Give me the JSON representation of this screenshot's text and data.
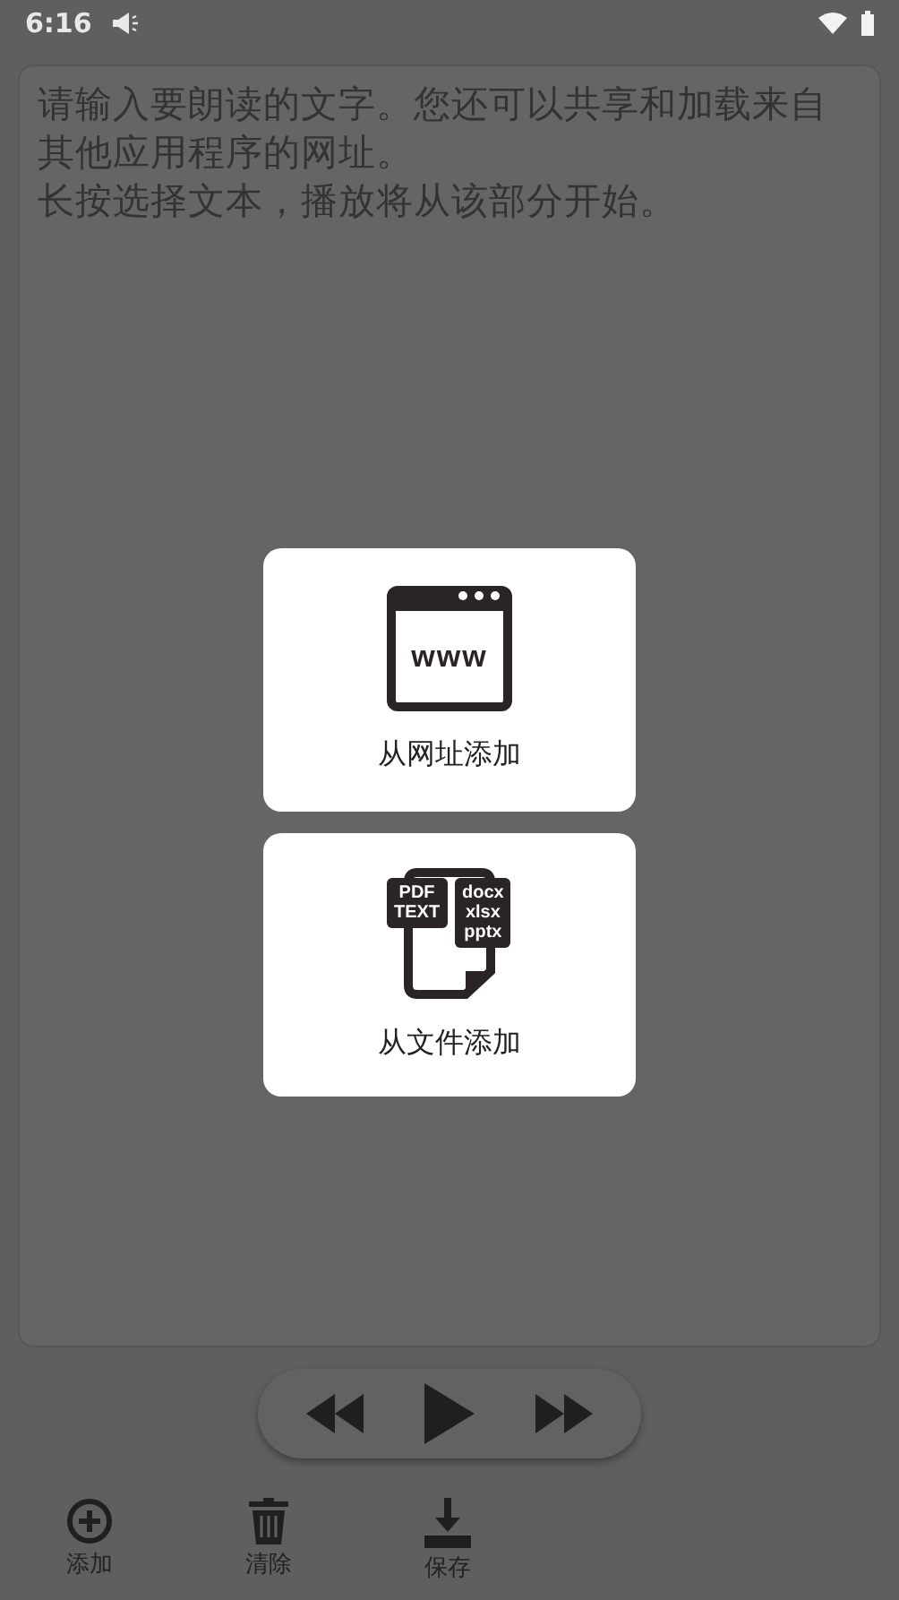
{
  "status_bar": {
    "time": "6:16"
  },
  "text_area": {
    "placeholder_lines": [
      "请输入要朗读的文字。您还可以共享和加载来自其他应用程序的网址。",
      "长按选择文本，播放将从该部分开始。"
    ]
  },
  "add_menu": [
    {
      "kind": "url",
      "label": "从网址添加",
      "icon_texts": [
        "www"
      ]
    },
    {
      "kind": "file",
      "label": "从文件添加",
      "icon_texts": [
        "PDF\nTEXT",
        "docx\nxlsx\npptx"
      ]
    }
  ],
  "player": {
    "buttons": [
      {
        "kind": "rewind"
      },
      {
        "kind": "play"
      },
      {
        "kind": "forward"
      }
    ]
  },
  "toolbar": [
    {
      "kind": "add",
      "label": "添加"
    },
    {
      "kind": "clear",
      "label": "清除"
    },
    {
      "kind": "save",
      "label": "保存"
    }
  ]
}
